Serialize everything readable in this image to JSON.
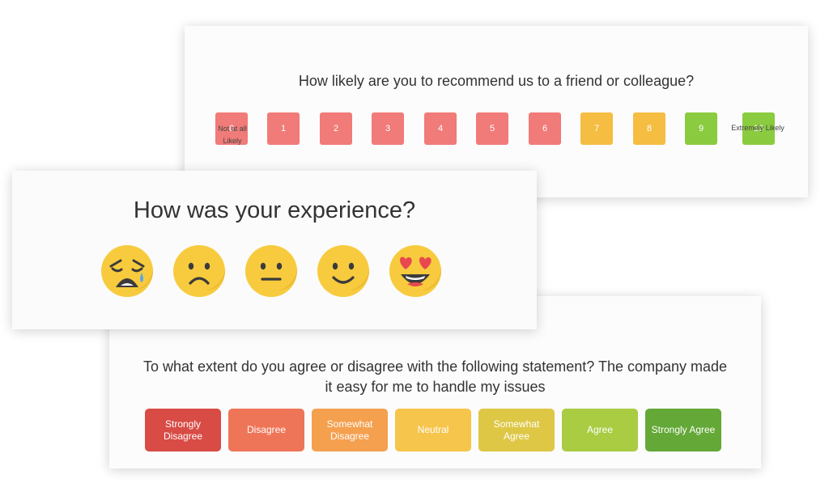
{
  "nps": {
    "question": "How likely are you to recommend us to a friend or colleague?",
    "options": [
      {
        "label": "0",
        "color": "#f07b78"
      },
      {
        "label": "1",
        "color": "#f07b78"
      },
      {
        "label": "2",
        "color": "#f07b78"
      },
      {
        "label": "3",
        "color": "#f07b78"
      },
      {
        "label": "4",
        "color": "#f07b78"
      },
      {
        "label": "5",
        "color": "#f07b78"
      },
      {
        "label": "6",
        "color": "#f07b78"
      },
      {
        "label": "7",
        "color": "#f5bd42"
      },
      {
        "label": "8",
        "color": "#f5bd42"
      },
      {
        "label": "9",
        "color": "#8acb3f"
      },
      {
        "label": "10",
        "color": "#8acb3f"
      }
    ],
    "low_label": "Not at all Likely",
    "high_label": "Extremely Likely"
  },
  "emoji": {
    "question": "How was your experience?",
    "options": [
      {
        "icon": "crying-face-icon"
      },
      {
        "icon": "frowning-face-icon"
      },
      {
        "icon": "neutral-face-icon"
      },
      {
        "icon": "slightly-smiling-face-icon"
      },
      {
        "icon": "heart-eyes-face-icon"
      }
    ],
    "face_color": "#f7cb3d"
  },
  "likert": {
    "question": "To what extent do you agree or disagree with the following statement? The company made it easy for me to handle my issues",
    "options": [
      {
        "label": "Strongly Disagree",
        "color": "#d84c45"
      },
      {
        "label": "Disagree",
        "color": "#ef7559"
      },
      {
        "label": "Somewhat Disagree",
        "color": "#f4a04f"
      },
      {
        "label": "Neutral",
        "color": "#f6c54c"
      },
      {
        "label": "Somewhat Agree",
        "color": "#dec745"
      },
      {
        "label": "Agree",
        "color": "#a9cc43"
      },
      {
        "label": "Strongly Agree",
        "color": "#64a837"
      }
    ]
  }
}
